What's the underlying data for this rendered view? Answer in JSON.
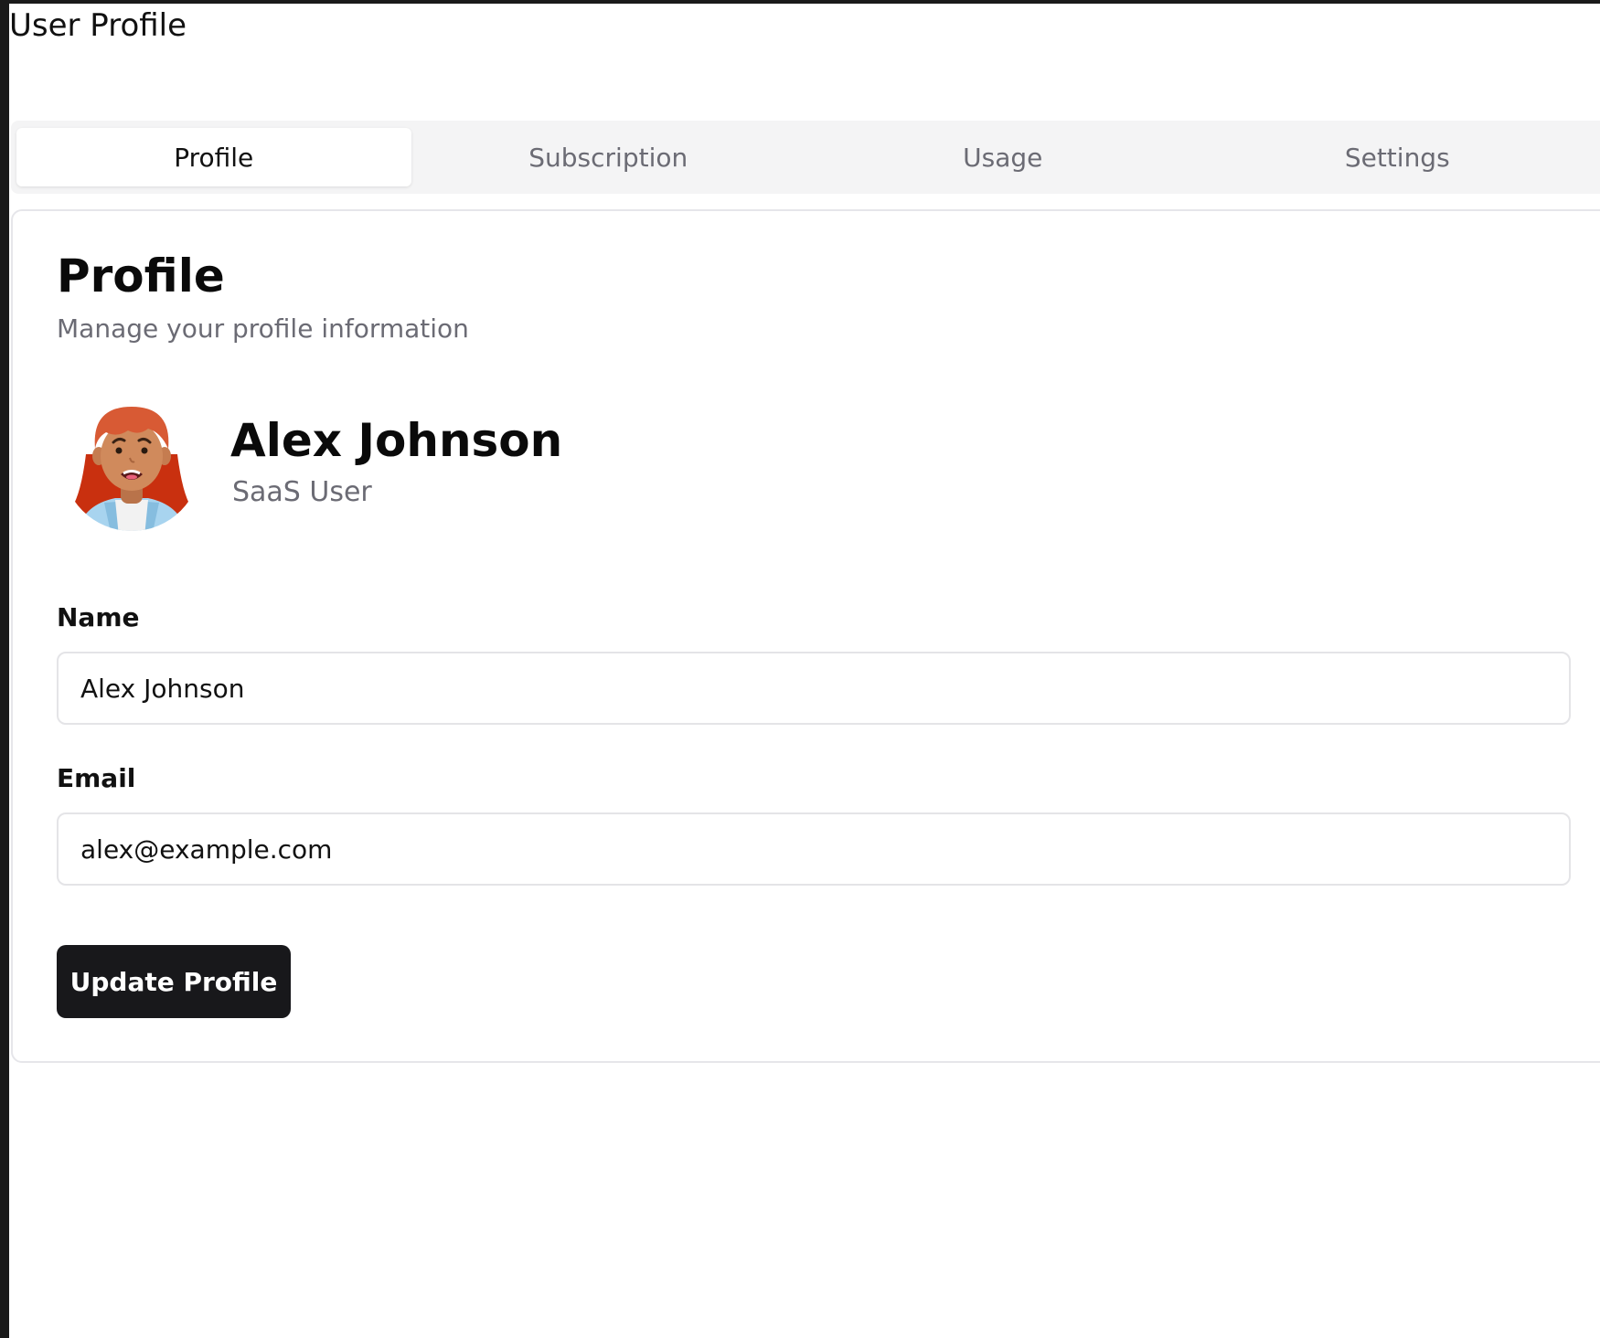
{
  "page": {
    "title": "User Profile"
  },
  "tabs": [
    {
      "label": "Profile",
      "active": true
    },
    {
      "label": "Subscription",
      "active": false
    },
    {
      "label": "Usage",
      "active": false
    },
    {
      "label": "Settings",
      "active": false
    }
  ],
  "card": {
    "title": "Profile",
    "subtitle": "Manage your profile information"
  },
  "user": {
    "name": "Alex Johnson",
    "role": "SaaS User",
    "avatar_icon": "user-avatar-illustration"
  },
  "form": {
    "name_label": "Name",
    "name_value": "Alex Johnson",
    "email_label": "Email",
    "email_value": "alex@example.com",
    "submit_label": "Update Profile"
  },
  "colors": {
    "primary_button": "#18181b",
    "muted_text": "#6b6b74",
    "tab_bar_bg": "#f4f4f5",
    "border": "#e4e4e7"
  }
}
